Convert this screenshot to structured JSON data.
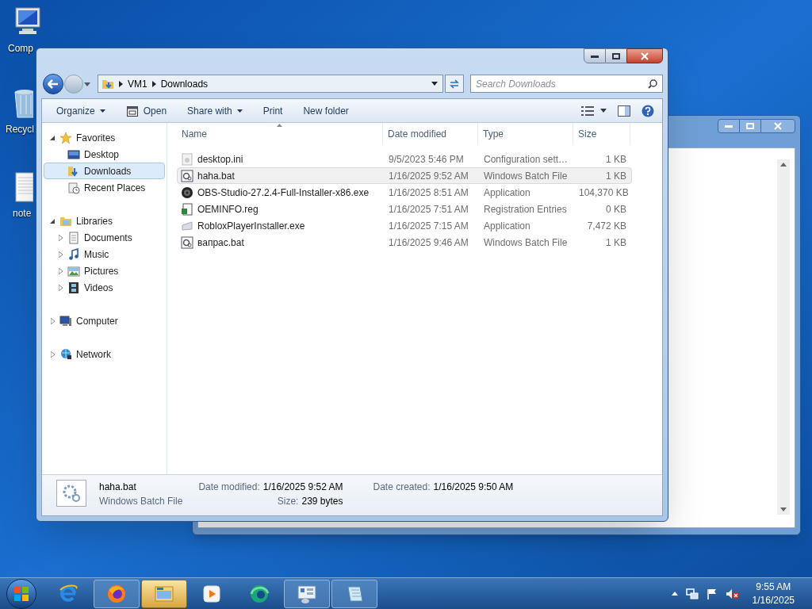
{
  "desktop_icons": [
    {
      "label": "Comp",
      "kind": "computer"
    },
    {
      "label": "Recycl",
      "kind": "recycle"
    },
    {
      "label": "note",
      "kind": "document"
    }
  ],
  "explorer": {
    "breadcrumb": [
      "VM1",
      "Downloads"
    ],
    "search": {
      "placeholder": "Search Downloads"
    },
    "toolbar": [
      {
        "label": "Organize",
        "kind": "menu"
      },
      {
        "label": "Open",
        "kind": "action"
      },
      {
        "label": "Share with",
        "kind": "menu"
      },
      {
        "label": "Print",
        "kind": "plain"
      },
      {
        "label": "New folder",
        "kind": "plain"
      }
    ],
    "nav": [
      {
        "label": "Favorites",
        "kind": "star",
        "expanded": true,
        "selected": false,
        "children": [
          {
            "label": "Desktop",
            "kind": "desktop",
            "selected": false
          },
          {
            "label": "Downloads",
            "kind": "downloads",
            "selected": true
          },
          {
            "label": "Recent Places",
            "kind": "recent",
            "selected": false
          }
        ]
      },
      {
        "label": "Libraries",
        "kind": "library",
        "expanded": true,
        "selected": false,
        "children": [
          {
            "label": "Documents",
            "kind": "documents",
            "expanded": false,
            "selected": false
          },
          {
            "label": "Music",
            "kind": "music",
            "expanded": false,
            "selected": false
          },
          {
            "label": "Pictures",
            "kind": "pictures",
            "expanded": false,
            "selected": false
          },
          {
            "label": "Videos",
            "kind": "videos",
            "expanded": false,
            "selected": false
          }
        ]
      },
      {
        "label": "Computer",
        "kind": "computer",
        "expanded": false,
        "selected": false
      },
      {
        "label": "Network",
        "kind": "network",
        "expanded": false,
        "selected": false
      }
    ],
    "columns": [
      "Name",
      "Date modified",
      "Type",
      "Size"
    ],
    "rows": [
      {
        "name": "desktop.ini",
        "date": "9/5/2023 5:46 PM",
        "type": "Configuration sett…",
        "size": "1 KB",
        "kind": "ini",
        "selected": false
      },
      {
        "name": "haha.bat",
        "date": "1/16/2025 9:52 AM",
        "type": "Windows Batch File",
        "size": "1 KB",
        "kind": "bat",
        "selected": true
      },
      {
        "name": "OBS-Studio-27.2.4-Full-Installer-x86.exe",
        "date": "1/16/2025 8:51 AM",
        "type": "Application",
        "size": "104,370 KB",
        "kind": "obs",
        "selected": false
      },
      {
        "name": "OEMINFO.reg",
        "date": "1/16/2025 7:51 AM",
        "type": "Registration Entries",
        "size": "0 KB",
        "kind": "reg",
        "selected": false
      },
      {
        "name": "RobloxPlayerInstaller.exe",
        "date": "1/16/2025 7:15 AM",
        "type": "Application",
        "size": "7,472 KB",
        "kind": "exe",
        "selected": false
      },
      {
        "name": "вапрас.bat",
        "date": "1/16/2025 9:46 AM",
        "type": "Windows Batch File",
        "size": "1 KB",
        "kind": "bat",
        "selected": false
      }
    ],
    "details": {
      "name": "haha.bat",
      "type": "Windows Batch File",
      "fields": [
        {
          "label": "Date modified:",
          "value": "1/16/2025 9:52 AM"
        },
        {
          "label": "Size:",
          "value": "239 bytes"
        },
        {
          "label": "Date created:",
          "value": "1/16/2025 9:50 AM"
        }
      ]
    }
  },
  "taskbar": {
    "apps": [
      {
        "kind": "ie",
        "active": false
      },
      {
        "kind": "firefox",
        "active": false
      },
      {
        "kind": "explorer",
        "active": true
      },
      {
        "kind": "media",
        "active": false
      },
      {
        "kind": "edge",
        "active": false
      },
      {
        "kind": "control",
        "active": false
      },
      {
        "kind": "notepad",
        "active": false
      }
    ],
    "time": "9:55 AM",
    "date": "1/16/2025"
  }
}
